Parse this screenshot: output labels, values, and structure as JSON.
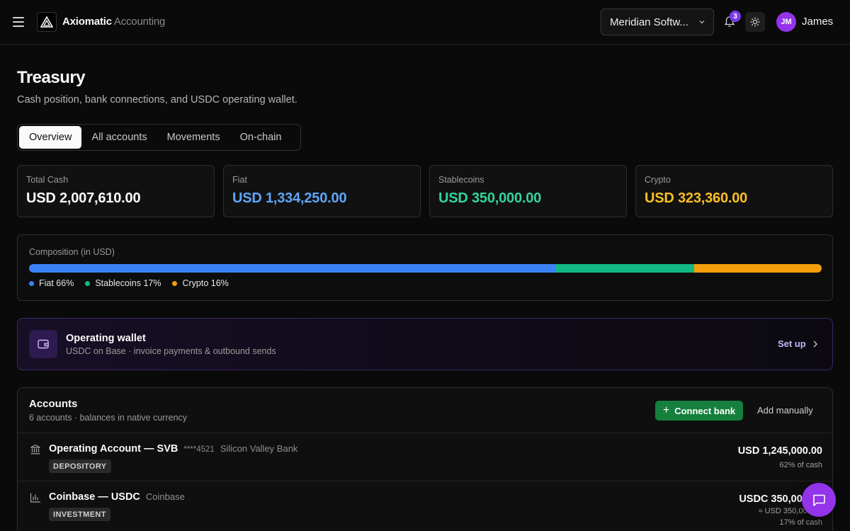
{
  "app": {
    "brand_primary": "Axiomatic",
    "brand_secondary": "Accounting",
    "org_selector": "Meridian Softw...",
    "notifications_count": "3",
    "user_initials": "JM",
    "user_name": "James"
  },
  "header": {
    "title": "Treasury",
    "subtitle": "Cash position, bank connections, and USDC operating wallet."
  },
  "tabs": [
    {
      "label": "Overview",
      "active": true
    },
    {
      "label": "All accounts",
      "active": false
    },
    {
      "label": "Movements",
      "active": false
    },
    {
      "label": "On-chain",
      "active": false
    }
  ],
  "stats": [
    {
      "label": "Total Cash",
      "value": "USD 2,007,610.00",
      "color": "#fafafa"
    },
    {
      "label": "Fiat",
      "value": "USD 1,334,250.00",
      "color": "#60a5fa"
    },
    {
      "label": "Stablecoins",
      "value": "USD 350,000.00",
      "color": "#34d399"
    },
    {
      "label": "Crypto",
      "value": "USD 323,360.00",
      "color": "#fbbf24"
    }
  ],
  "composition": {
    "label": "Composition (in USD)",
    "segments": [
      {
        "name": "Fiat",
        "legend": "Fiat 66%",
        "percent": 66.46,
        "color": "#3b82f6"
      },
      {
        "name": "Stablecoins",
        "legend": "Stablecoins 17%",
        "percent": 17.43,
        "color": "#10b981"
      },
      {
        "name": "Crypto",
        "legend": "Crypto 16%",
        "percent": 16.11,
        "color": "#f59e0b"
      }
    ]
  },
  "wallet": {
    "title": "Operating wallet",
    "subtitle": "USDC on Base · invoice payments & outbound sends",
    "action": "Set up"
  },
  "accounts": {
    "title": "Accounts",
    "subtitle": "6 accounts · balances in native currency",
    "connect_label": "Connect bank",
    "add_label": "Add manually",
    "rows": [
      {
        "icon": "bank-icon",
        "name": "Operating Account — SVB",
        "mask": "****4521",
        "bank": "Silicon Valley Bank",
        "tag": "DEPOSITORY",
        "amount": "USD 1,245,000.00",
        "usd_equiv": "",
        "share": "62% of cash"
      },
      {
        "icon": "chart-icon",
        "name": "Coinbase — USDC",
        "mask": "",
        "bank": "Coinbase",
        "tag": "INVESTMENT",
        "amount": "USDC 350,000.00",
        "usd_equiv": "≈ USD 350,000.00",
        "share": "17% of cash"
      }
    ]
  }
}
